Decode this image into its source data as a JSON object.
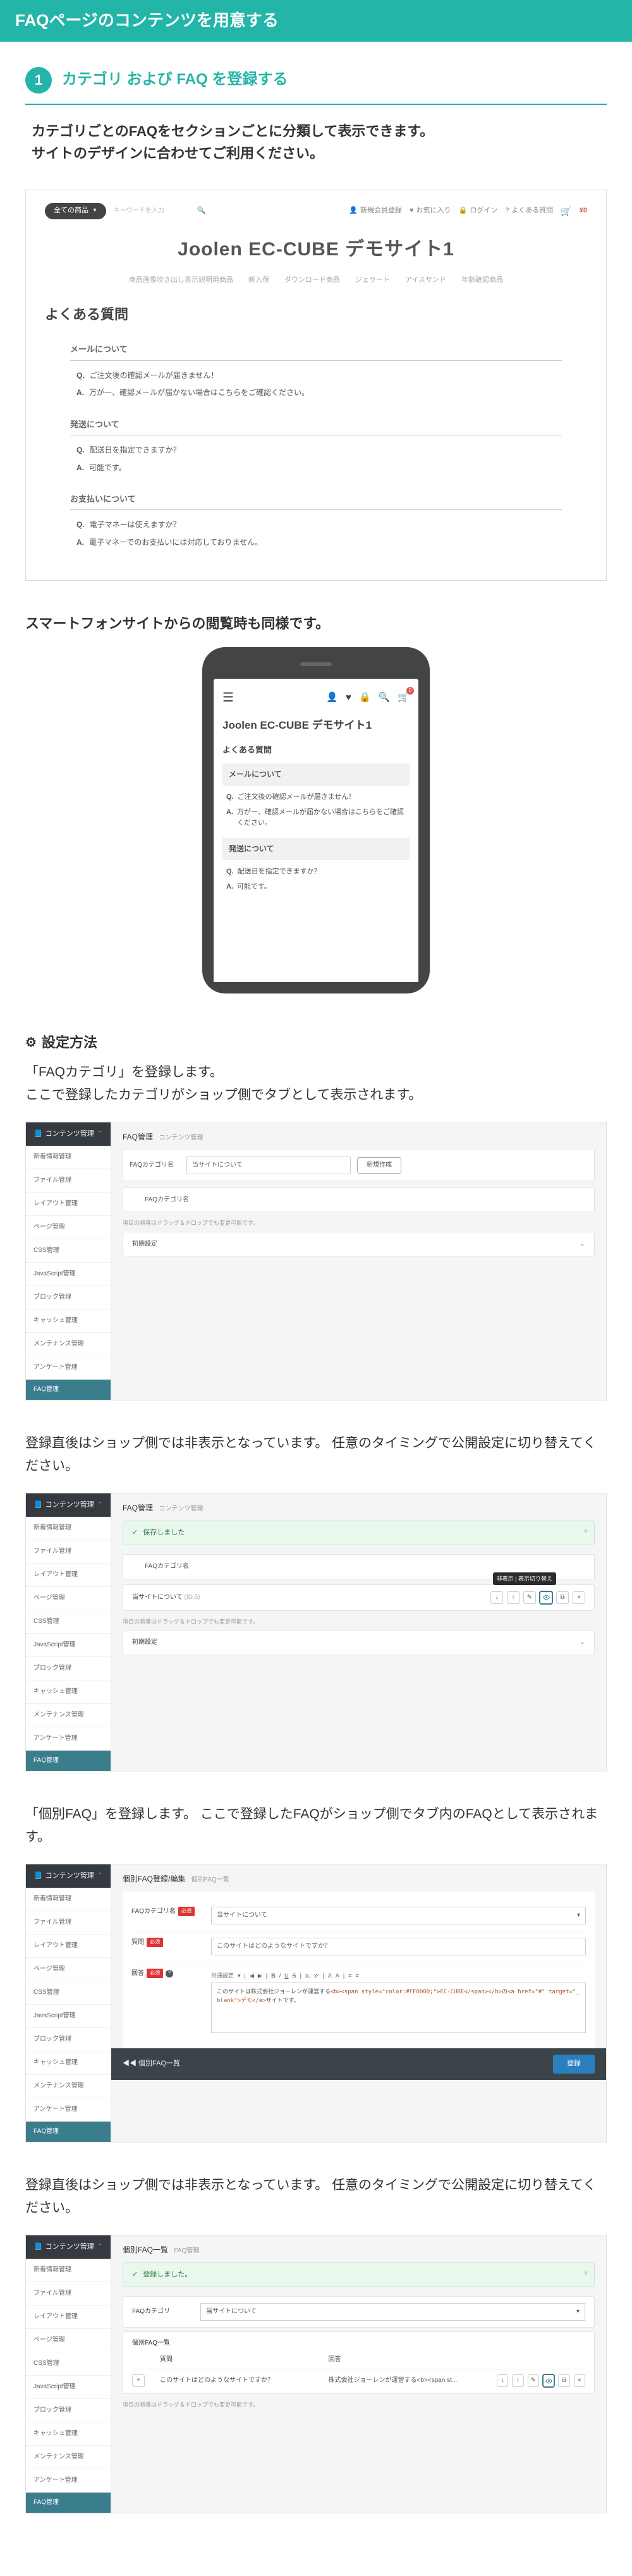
{
  "title": "FAQページのコンテンツを用意する",
  "step1": {
    "num": "1",
    "title": "カテゴリ および FAQ を登録する",
    "desc": "カテゴリごとのFAQをセクションごとに分類して表示できます。\nサイトのデザインに合わせてご利用ください。"
  },
  "shop": {
    "all_products": "全ての商品",
    "search_ph": "キーワードを入力",
    "nav_register": "新規会員登録",
    "nav_fav": "お気に入り",
    "nav_login": "ログイン",
    "nav_faq": "よくある質問",
    "cart_price": "¥0",
    "title": "Joolen EC-CUBE デモサイト1",
    "nav_items": [
      "商品画像吹き出し表示説明用商品",
      "新入荷",
      "ダウンロード商品",
      "ジェラート",
      "アイスサンド",
      "年齢確認商品"
    ],
    "heading": "よくある質問",
    "cats": [
      {
        "name": "メールについて",
        "qa": [
          {
            "q": "ご注文後の確認メールが届きません！",
            "a": "万が一、確認メールが届かない場合はこちらをご確認ください。"
          }
        ]
      },
      {
        "name": "発送について",
        "qa": [
          {
            "q": "配送日を指定できますか？",
            "a": "可能です。"
          }
        ]
      },
      {
        "name": "お支払いについて",
        "qa": [
          {
            "q": "電子マネーは使えますか？",
            "a": "電子マネーでのお支払いには対応しておりません。"
          }
        ]
      }
    ]
  },
  "smartphone_note": "スマートフォンサイトからの閲覧時も同様です。",
  "phone": {
    "title": "Joolen EC-CUBE デモサイト1",
    "heading": "よくある質問",
    "cats": [
      {
        "name": "メールについて",
        "qa": [
          {
            "q": "ご注文後の確認メールが届きません！",
            "a": "万が一、確認メールが届かない場合はこちらをご確認ください。"
          }
        ]
      },
      {
        "name": "発送について",
        "qa": [
          {
            "q": "配送日を指定できますか？",
            "a": "可能です。"
          }
        ]
      }
    ],
    "badge": "0"
  },
  "settings_heading": "設定方法",
  "settings1_text": "「FAQカテゴリ」を登録します。\nここで登録したカテゴリがショップ側でタブとして表示されます。",
  "admin": {
    "side_head": "コンテンツ管理",
    "side_items": [
      "新着情報管理",
      "ファイル管理",
      "レイアウト管理",
      "ページ管理",
      "CSS管理",
      "JavaScript管理",
      "ブロック管理",
      "キャッシュ管理",
      "メンテナンス管理",
      "アンケート管理"
    ],
    "side_foot": "FAQ管理",
    "crumb_faq": "FAQ管理",
    "crumb_content": "コンテンツ管理",
    "faq_cat_label": "FAQカテゴリ名",
    "faq_cat_ph": "当サイトについて",
    "btn_new": "新規作成",
    "drag_note": "項目の順番はドラッグ＆ドロップでも変更可能です。",
    "initial_setting": "初期設定",
    "saved_msg": "保存しました",
    "cat_value": "当サイトについて",
    "cat_id_prefix": "(ID:",
    "cat_id": "5)",
    "tooltip_hidden": "非表示 | 表示切り替え"
  },
  "settings2_text": "登録直後はショップ側では非表示となっています。\n任意のタイミングで公開設定に切り替えてください。",
  "settings3_text": "「個別FAQ」を登録します。\nここで登録したFAQがショップ側でタブ内のFAQとして表示されます。",
  "admin3": {
    "crumb": "個別FAQ登録/編集",
    "crumb_sub": "個別FAQ一覧",
    "label_cat": "FAQカテゴリ名",
    "label_q": "質問",
    "label_a": "回答",
    "select_value": "当サイトについて",
    "q_value": "このサイトはどのようなサイトですか？",
    "editor_toolbar": [
      "共通設定",
      "▾",
      "|",
      "◀",
      "▶",
      "|",
      "B",
      "I",
      "U",
      "S",
      "|",
      "x₂",
      "x²",
      "|",
      "A",
      "A",
      "|",
      "≡",
      "≡"
    ],
    "a_html_prefix": "このサイトは株式会社ジョーレンが運営する",
    "a_html_tag": "<b><span style=\"color:#FF0000;\">EC-CUBE</span></b>",
    "a_html_mid": "の",
    "a_html_tag2": "<a href=\"#\" target=\"_blank\">デモ</a>",
    "a_html_suffix": "サイトです。",
    "back": "◀◀ 個別FAQ一覧",
    "submit": "登録"
  },
  "settings4_text": "登録直後はショップ側では非表示となっています。\n任意のタイミングで公開設定に切り替えてください。",
  "admin4": {
    "crumb": "個別FAQ一覧",
    "crumb_sub": "FAQ管理",
    "saved_msg": "登録しました。",
    "label_cat": "FAQカテゴリ",
    "label_list": "個別FAQ一覧",
    "th_q": "質問",
    "th_a": "回答",
    "row_q": "このサイトはどのようなサイトですか？",
    "row_a": "株式会社ジョーレンが運営する<b><span st...",
    "drag_note": "項目の順番はドラッグ＆ドロップでも変更可能です。"
  }
}
